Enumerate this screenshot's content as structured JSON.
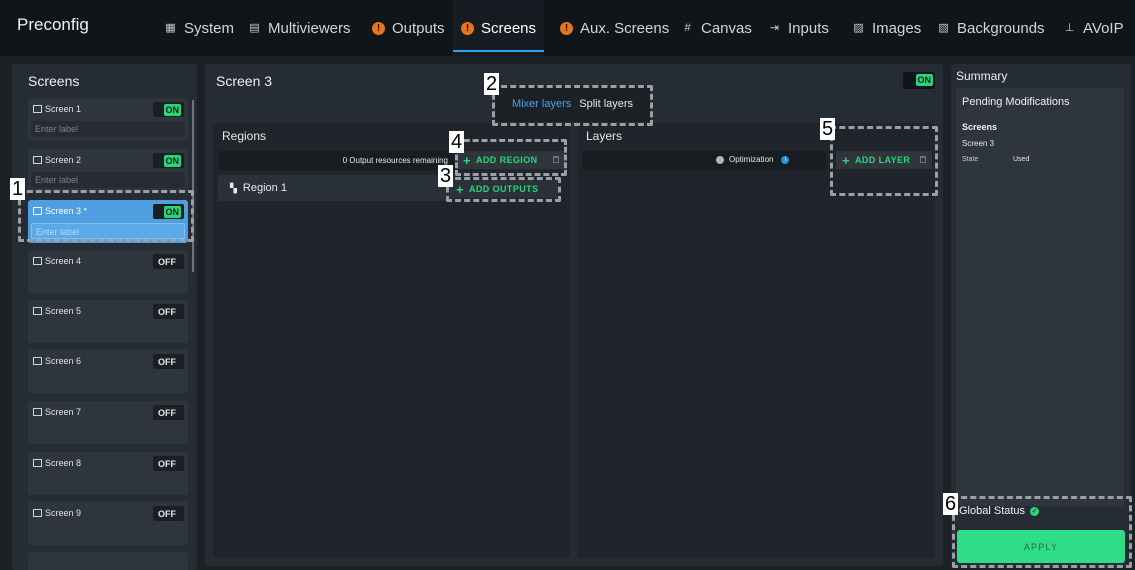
{
  "app": {
    "title": "Preconfig"
  },
  "nav": {
    "tabs": [
      {
        "label": "System",
        "icon": "chart-icon"
      },
      {
        "label": "Multiviewers",
        "icon": "monitor-icon"
      },
      {
        "label": "Outputs",
        "icon": "warning-icon"
      },
      {
        "label": "Screens",
        "icon": "warning-icon",
        "active": true
      },
      {
        "label": "Aux. Screens",
        "icon": "warning-icon"
      },
      {
        "label": "Canvas",
        "icon": "hash-icon"
      },
      {
        "label": "Inputs",
        "icon": "input-icon"
      },
      {
        "label": "Images",
        "icon": "image-icon"
      },
      {
        "label": "Backgrounds",
        "icon": "layers-icon"
      },
      {
        "label": "AVoIP",
        "icon": "network-icon"
      }
    ]
  },
  "screens": {
    "heading": "Screens",
    "label_placeholder": "Enter label",
    "items": [
      {
        "name": "Screen 1",
        "state": "ON"
      },
      {
        "name": "Screen 2",
        "state": "ON"
      },
      {
        "name": "Screen 3 *",
        "state": "ON",
        "selected": true
      },
      {
        "name": "Screen 4",
        "state": "OFF"
      },
      {
        "name": "Screen 5",
        "state": "OFF"
      },
      {
        "name": "Screen 6",
        "state": "OFF"
      },
      {
        "name": "Screen 7",
        "state": "OFF"
      },
      {
        "name": "Screen 8",
        "state": "OFF"
      },
      {
        "name": "Screen 9",
        "state": "OFF"
      }
    ]
  },
  "main": {
    "title": "Screen 3",
    "toggle": "ON",
    "segment": {
      "mixer": "Mixer layers",
      "split": "Split layers"
    },
    "regions": {
      "heading": "Regions",
      "remaining": "0 Output resources remaining",
      "add_region": "ADD REGION",
      "add_outputs": "ADD OUTPUTS",
      "items": [
        "Region 1"
      ]
    },
    "layers": {
      "heading": "Layers",
      "optimization": "Optimization",
      "add_layer": "ADD LAYER"
    }
  },
  "summary": {
    "heading": "Summary",
    "pending": "Pending Modifications",
    "section": "Screens",
    "screen": "Screen 3",
    "key": "State",
    "value": "Used",
    "global_status": "Global Status",
    "apply": "APPLY"
  },
  "annotations": [
    "1",
    "2",
    "3",
    "4",
    "5",
    "6"
  ],
  "colors": {
    "accent": "#2ea0e6",
    "on": "#2bd67b",
    "warning": "#e8741c",
    "apply": "#2fdc88"
  }
}
